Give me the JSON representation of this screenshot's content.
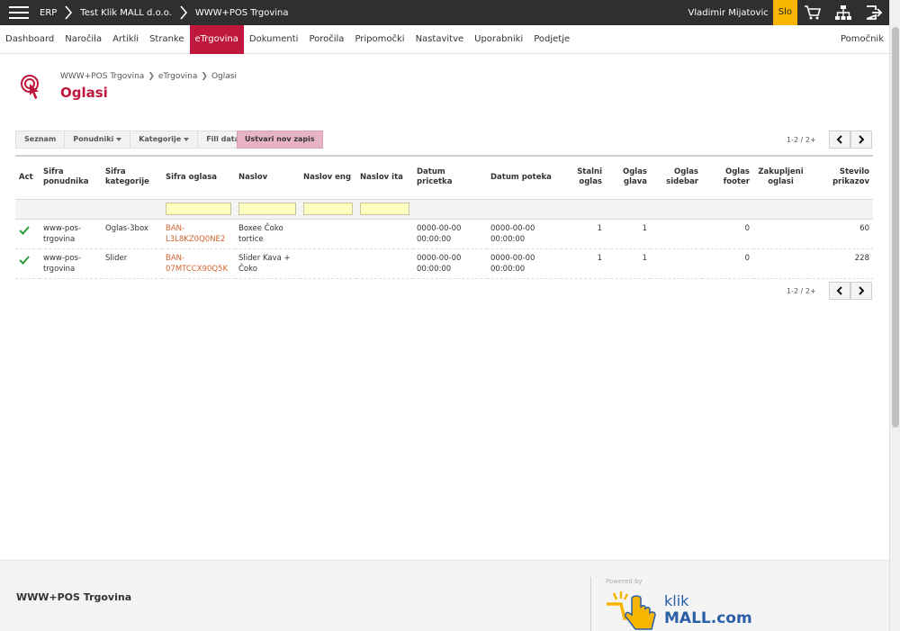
{
  "topbar": {
    "breadcrumbs": [
      "ERP",
      "Test Klik MALL d.o.o.",
      "WWW+POS Trgovina"
    ],
    "user": "Vladimir Mijatovic",
    "language": "Slo"
  },
  "nav": {
    "items": [
      "Dashboard",
      "Naročila",
      "Artikli",
      "Stranke",
      "eTrgovina",
      "Dokumenti",
      "Poročila",
      "Pripomočki",
      "Nastavitve",
      "Uporabniki",
      "Podjetje"
    ],
    "active": "eTrgovina",
    "help": "Pomočnik"
  },
  "page": {
    "breadcrumb": [
      "WWW+POS Trgovina",
      "eTrgovina",
      "Oglasi"
    ],
    "title": "Oglasi"
  },
  "toolbar": {
    "seznam": "Seznam",
    "ponudniki": "Ponudniki",
    "kategorije": "Kategorije",
    "fill_data": "Fill data",
    "create": "Ustvari nov zapis"
  },
  "pager": {
    "info": "1-2 / 2+"
  },
  "table": {
    "headers": {
      "act": "Act",
      "sifra_ponudnika": "Sifra ponudnika",
      "sifra_kategorije": "Sifra kategorije",
      "sifra_oglasa": "Sifra oglasa",
      "naslov": "Naslov",
      "naslov_eng": "Naslov eng",
      "naslov_ita": "Naslov ita",
      "datum_pricetka": "Datum pricetka",
      "datum_poteka": "Datum poteka",
      "stalni_oglas": "Stalni oglas",
      "oglas_glava": "Oglas glava",
      "oglas_sidebar": "Oglas sidebar",
      "oglas_footer": "Oglas footer",
      "zakupljeni_oglasi": "Zakupljeni oglasi",
      "stevilo_prikazov": "Stevilo prikazov"
    },
    "rows": [
      {
        "sifra_ponudnika": "www-pos-trgovina",
        "sifra_kategorije": "Oglas-3box",
        "sifra_oglasa": "BAN-L3L8KZ0Q0NE2",
        "naslov": "Boxee Čoko tortice",
        "naslov_eng": "",
        "naslov_ita": "",
        "datum_pricetka": "0000-00-00 00:00:00",
        "datum_poteka": "0000-00-00 00:00:00",
        "stalni_oglas": "1",
        "oglas_glava": "1",
        "oglas_sidebar": "",
        "oglas_footer": "0",
        "zakupljeni_oglasi": "",
        "stevilo_prikazov": "60"
      },
      {
        "sifra_ponudnika": "www-pos-trgovina",
        "sifra_kategorije": "Slider",
        "sifra_oglasa": "BAN-07MTCCX90Q5K",
        "naslov": "Slider Kava + Čoko",
        "naslov_eng": "",
        "naslov_ita": "",
        "datum_pricetka": "0000-00-00 00:00:00",
        "datum_poteka": "0000-00-00 00:00:00",
        "stalni_oglas": "1",
        "oglas_glava": "1",
        "oglas_sidebar": "",
        "oglas_footer": "0",
        "zakupljeni_oglasi": "",
        "stevilo_prikazov": "228"
      }
    ]
  },
  "footer": {
    "company": "WWW+POS Trgovina",
    "powered_by": "Powered by",
    "logo_top": "klik",
    "logo_bottom": "MALL.com"
  },
  "colors": {
    "topbar": "#2f2f2f",
    "accent": "#c0183c",
    "language_badge": "#f7b500",
    "link": "#d2622e",
    "check": "#2a9d3a",
    "logo_blue": "#2a5fa8"
  }
}
